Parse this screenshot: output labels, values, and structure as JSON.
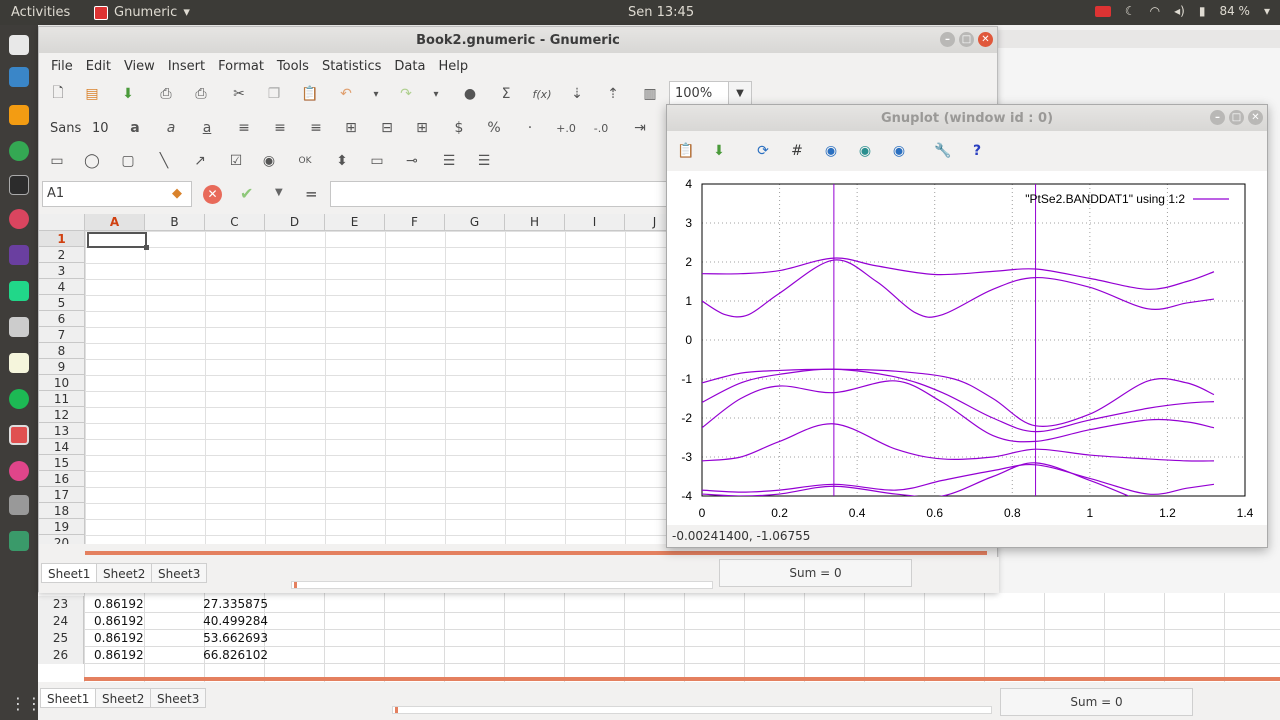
{
  "topbar": {
    "activities": "Activities",
    "app_name": "Gnumeric",
    "clock": "Sen 13:45",
    "battery": "84 %"
  },
  "main_window": {
    "title": "Book2.gnumeric - Gnumeric",
    "menu": [
      "File",
      "Edit",
      "View",
      "Insert",
      "Format",
      "Tools",
      "Statistics",
      "Data",
      "Help"
    ],
    "zoom": "100%",
    "font_name": "Sans",
    "font_size": "10",
    "name_box": "A1",
    "formula_eq": "=",
    "columns": [
      "A",
      "B",
      "C",
      "D",
      "E",
      "F",
      "G",
      "H",
      "I",
      "J"
    ],
    "rows": [
      "1",
      "2",
      "3",
      "4",
      "5",
      "6",
      "7",
      "8",
      "9",
      "10",
      "11",
      "12",
      "13",
      "14",
      "15",
      "16",
      "17",
      "18",
      "19",
      "20"
    ],
    "selected_col": "A",
    "selected_row": "1",
    "sheets": [
      "Sheet1",
      "Sheet2",
      "Sheet3"
    ],
    "sum": "Sum = 0"
  },
  "background_window": {
    "rows": [
      {
        "num": "23",
        "a": "0.86192",
        "b": "27.335875"
      },
      {
        "num": "24",
        "a": "0.86192",
        "b": "40.499284"
      },
      {
        "num": "25",
        "a": "0.86192",
        "b": "53.662693"
      },
      {
        "num": "26",
        "a": "0.86192",
        "b": "66.826102"
      }
    ],
    "sheets": [
      "Sheet1",
      "Sheet2",
      "Sheet3"
    ],
    "sum": "Sum = 0"
  },
  "gnuplot": {
    "title": "Gnuplot (window id : 0)",
    "status": "-0.00241400, -1.06755",
    "colors": {
      "curve": "#9400d3",
      "grid": "#a0a0a0"
    }
  },
  "chart_data": {
    "type": "line",
    "title": "",
    "xlabel": "",
    "ylabel": "",
    "xlim": [
      0,
      1.4
    ],
    "ylim": [
      -4,
      4
    ],
    "xticks": [
      "0",
      "0.2",
      "0.4",
      "0.6",
      "0.8",
      "1",
      "1.2",
      "1.4"
    ],
    "yticks": [
      "4",
      "3",
      "2",
      "1",
      "0",
      "-1",
      "-2",
      "-3",
      "-4"
    ],
    "grid": true,
    "legend": {
      "position": "top-right",
      "entries": [
        "\"PtSe2.BANDDAT1\" using 1:2"
      ]
    },
    "vlines": [
      0.34,
      0.86
    ],
    "series": [
      {
        "x": [
          0.0,
          0.1,
          0.2,
          0.34,
          0.45,
          0.6,
          0.75,
          0.86,
          1.0,
          1.15,
          1.25,
          1.32
        ],
        "y": [
          1.7,
          1.7,
          1.78,
          2.1,
          1.9,
          1.68,
          1.76,
          1.82,
          1.58,
          1.3,
          1.5,
          1.75
        ]
      },
      {
        "x": [
          0.0,
          0.06,
          0.12,
          0.2,
          0.34,
          0.45,
          0.55,
          0.62,
          0.75,
          0.86,
          1.0,
          1.15,
          1.25,
          1.32
        ],
        "y": [
          1.0,
          0.65,
          0.65,
          1.2,
          2.05,
          1.5,
          0.7,
          0.65,
          1.3,
          1.6,
          1.35,
          0.8,
          0.95,
          1.05
        ]
      },
      {
        "x": [
          0.0,
          0.1,
          0.2,
          0.34,
          0.5,
          0.65,
          0.75,
          0.86,
          1.0,
          1.15,
          1.25,
          1.32
        ],
        "y": [
          -1.1,
          -0.85,
          -0.78,
          -0.75,
          -0.8,
          -1.0,
          -1.5,
          -2.2,
          -1.9,
          -1.05,
          -1.1,
          -1.4
        ]
      },
      {
        "x": [
          0.0,
          0.1,
          0.2,
          0.34,
          0.5,
          0.62,
          0.75,
          0.86,
          1.0,
          1.15,
          1.25,
          1.32
        ],
        "y": [
          -1.6,
          -1.1,
          -0.88,
          -0.75,
          -0.95,
          -1.35,
          -2.0,
          -2.35,
          -2.05,
          -1.75,
          -1.62,
          -1.58
        ]
      },
      {
        "x": [
          0.0,
          0.1,
          0.2,
          0.34,
          0.5,
          0.62,
          0.75,
          0.86,
          1.0,
          1.15,
          1.25,
          1.32
        ],
        "y": [
          -2.25,
          -1.5,
          -1.18,
          -1.35,
          -1.05,
          -1.6,
          -2.45,
          -2.6,
          -2.3,
          -2.05,
          -2.1,
          -2.25
        ]
      },
      {
        "x": [
          0.0,
          0.1,
          0.2,
          0.34,
          0.5,
          0.62,
          0.75,
          0.86,
          1.0,
          1.15,
          1.25,
          1.32
        ],
        "y": [
          -3.1,
          -3.0,
          -2.6,
          -2.15,
          -2.8,
          -3.05,
          -3.0,
          -2.8,
          -2.95,
          -3.05,
          -3.1,
          -3.1
        ]
      },
      {
        "x": [
          0.0,
          0.1,
          0.2,
          0.34,
          0.5,
          0.62,
          0.75,
          0.86,
          1.0,
          1.15,
          1.25,
          1.32
        ],
        "y": [
          -3.85,
          -3.9,
          -3.85,
          -3.7,
          -3.85,
          -3.6,
          -3.35,
          -3.2,
          -3.55,
          -3.95,
          -3.8,
          -3.7
        ]
      },
      {
        "x": [
          0.0,
          0.1,
          0.2,
          0.34,
          0.5,
          0.62,
          0.75,
          0.86,
          1.0,
          1.1
        ],
        "y": [
          -3.95,
          -4.0,
          -3.95,
          -3.75,
          -3.95,
          -4.0,
          -3.5,
          -3.15,
          -3.6,
          -4.0
        ]
      }
    ]
  }
}
